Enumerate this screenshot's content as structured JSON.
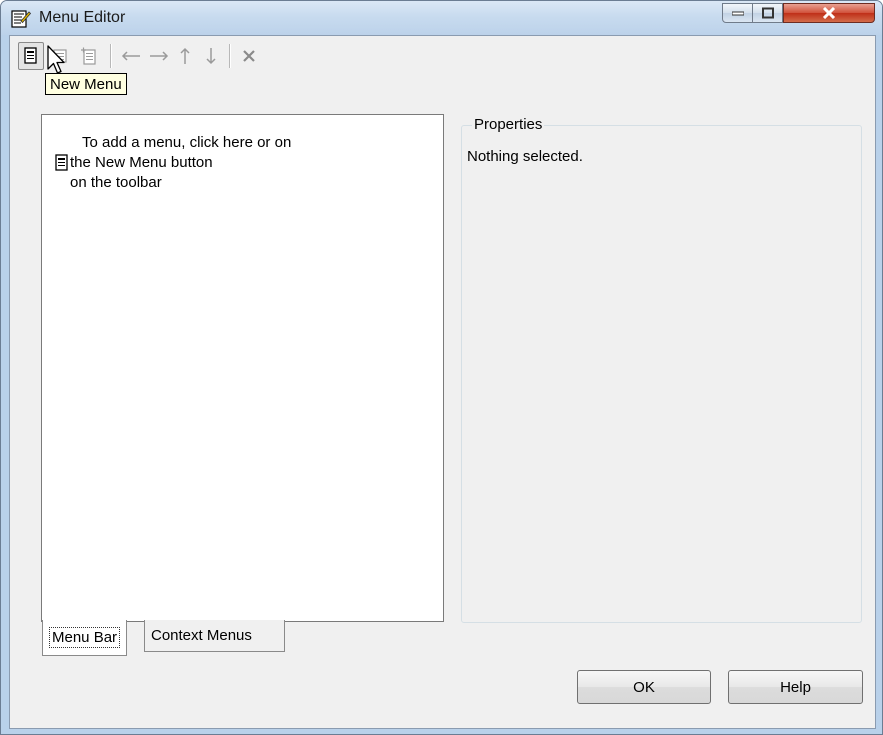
{
  "window": {
    "title": "Menu Editor",
    "controls": [
      "minimize-icon",
      "maximize-icon",
      "close-icon"
    ]
  },
  "toolbar": {
    "buttons": [
      {
        "name": "new-menu",
        "icon": "new-menu-icon",
        "state": "pressed"
      },
      {
        "name": "new-menu-item",
        "icon": "new-menu-item-icon",
        "state": "disabled"
      },
      {
        "name": "new-context-menu",
        "icon": "new-context-menu-icon",
        "state": "disabled"
      },
      {
        "name": "move-left",
        "icon": "arrow-left-icon",
        "state": "disabled"
      },
      {
        "name": "move-right",
        "icon": "arrow-right-icon",
        "state": "disabled"
      },
      {
        "name": "move-up",
        "icon": "arrow-up-icon",
        "state": "disabled"
      },
      {
        "name": "move-down",
        "icon": "arrow-down-icon",
        "state": "disabled"
      },
      {
        "name": "delete",
        "icon": "delete-icon",
        "state": "disabled"
      }
    ],
    "tooltip": "New Menu"
  },
  "tree": {
    "hint_line1": "To add a menu, click here or on",
    "hint_line2": "the New Menu button",
    "hint_line3": "on the toolbar"
  },
  "tabs": {
    "menu_bar": "Menu Bar",
    "context_menus": "Context Menus",
    "active": "Menu Bar"
  },
  "properties": {
    "title": "Properties",
    "empty_text": "Nothing selected."
  },
  "buttons": {
    "ok": "OK",
    "help": "Help"
  },
  "colors": {
    "window_frame": "#b9d1ea",
    "close_button": "#c7402a",
    "tooltip_bg": "#ffffe1",
    "client_bg": "#f0f0f0"
  }
}
